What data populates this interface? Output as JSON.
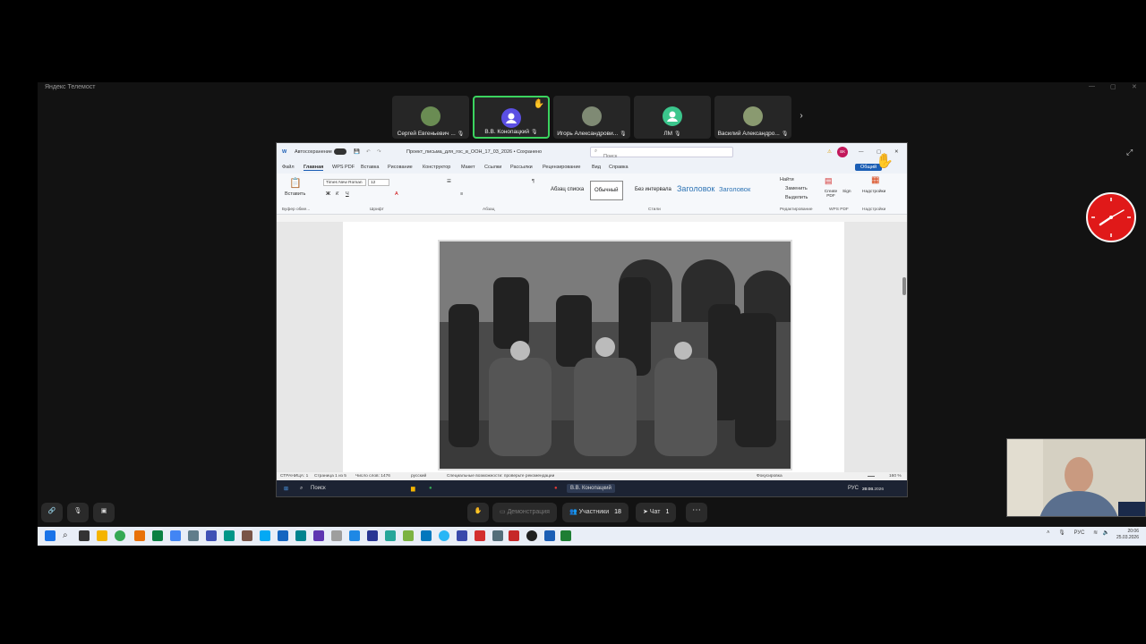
{
  "app": {
    "title": "Яндекс Телемост"
  },
  "participants": [
    {
      "name": "Сергей Евгеньевич ...",
      "avatar": "photo-avatar",
      "color": "#6a8c53"
    },
    {
      "name": "В.В. Конопацкий",
      "avatar": "default-avatar",
      "color": "#5b4fe3",
      "active": true,
      "hand": "raised-hand-icon"
    },
    {
      "name": "Игорь Александрови...",
      "avatar": "photo-avatar",
      "color": "#7f8a74"
    },
    {
      "name": "ЛМ",
      "avatar": "initials-avatar",
      "color": "#3bc68c"
    },
    {
      "name": "Василий Александро...",
      "avatar": "photo-avatar",
      "color": "#8a9a70"
    }
  ],
  "word": {
    "autosave": "Автосохранение",
    "doc_title": "Проект_письма_для_гос_в_ООН_17_03_2026 • Сохранено",
    "search_placeholder": "Поиск",
    "user_initials": "ВК",
    "share_button": "Общий",
    "tabs": [
      "Файл",
      "Главная",
      "WPS PDF",
      "Вставка",
      "Рисование",
      "Конструктор",
      "Макет",
      "Ссылки",
      "Рассылки",
      "Рецензирование",
      "Вид",
      "Справка"
    ],
    "active_tab": "Главная",
    "ribbon": {
      "paste": "Вставить",
      "font_name": "Times New Roman",
      "font_size": "12",
      "groups": [
        "Буфер обме...",
        "Шрифт",
        "Абзац",
        "Стили",
        "Редактирование",
        "WPS PDF",
        "Надстройки"
      ],
      "styles": [
        "Абзац списка",
        "Обычный",
        "Без интервала",
        "Заголовок",
        "Заголовок"
      ],
      "editing": [
        "Найти",
        "Заменить",
        "Выделить"
      ],
      "wps": [
        "Create PDF",
        "Sign"
      ],
      "addins": "Надстройки"
    },
    "status": {
      "page": "СТРАНИЦА: 1",
      "pages": "Страница 1 из 5",
      "words": "Число слов: 1476",
      "lang": "русский",
      "accessibility": "Специальные возможности: проверьте рекомендации",
      "focus": "Фокусировка",
      "zoom": "160 %"
    }
  },
  "inner_taskbar": {
    "search": "Поиск",
    "presenter": "В.В. Конопацкий",
    "lang": "РУС",
    "time": "20:06",
    "date": "25.03.2026"
  },
  "controls": {
    "demo": "Демонстрация",
    "participants": "Участники",
    "participants_count": "18",
    "chat": "Чат",
    "chat_count": "1"
  },
  "taskbar": {
    "lang": "РУС",
    "time": "20:06",
    "date": "25.03.2026"
  }
}
